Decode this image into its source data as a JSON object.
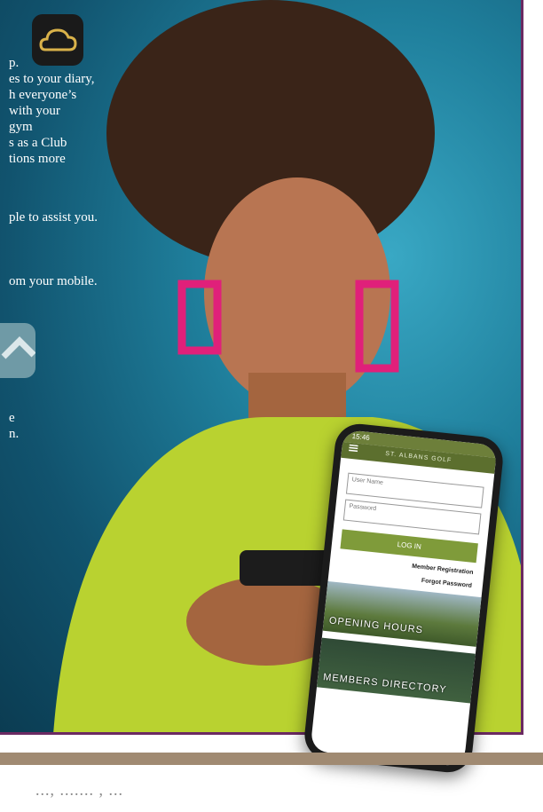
{
  "overlay_text": {
    "line1": "p.",
    "line2": "es to your diary,",
    "line3": "h everyone’s",
    "line4": "with your",
    "line5": "gym",
    "line6": "s as a Club",
    "line7": "tions more",
    "line8": "ple to assist you.",
    "line9": "om your mobile.",
    "line10": "e",
    "line11": "n."
  },
  "phone": {
    "status_time": "15:46",
    "app_title": "ST. ALBANS GOLF",
    "username_placeholder": "User Name",
    "password_placeholder": "Password",
    "login_label": "LOG IN",
    "member_registration": "Member Registration",
    "forgot_password": "Forgot Password",
    "tile1_label": "OPENING HOURS",
    "tile2_label": "MEMBERS DIRECTORY"
  },
  "footer": {
    "text": "..., ....... , ..."
  },
  "colors": {
    "photo_bg": "#1f7f9c",
    "frame_border": "#6b2a62",
    "app_green": "#5c6f2e",
    "login_green": "#7f9b3a",
    "footer_bar": "#a08a72"
  },
  "icons": [
    "cloud-icon",
    "chevron-up-icon",
    "menu-icon"
  ]
}
